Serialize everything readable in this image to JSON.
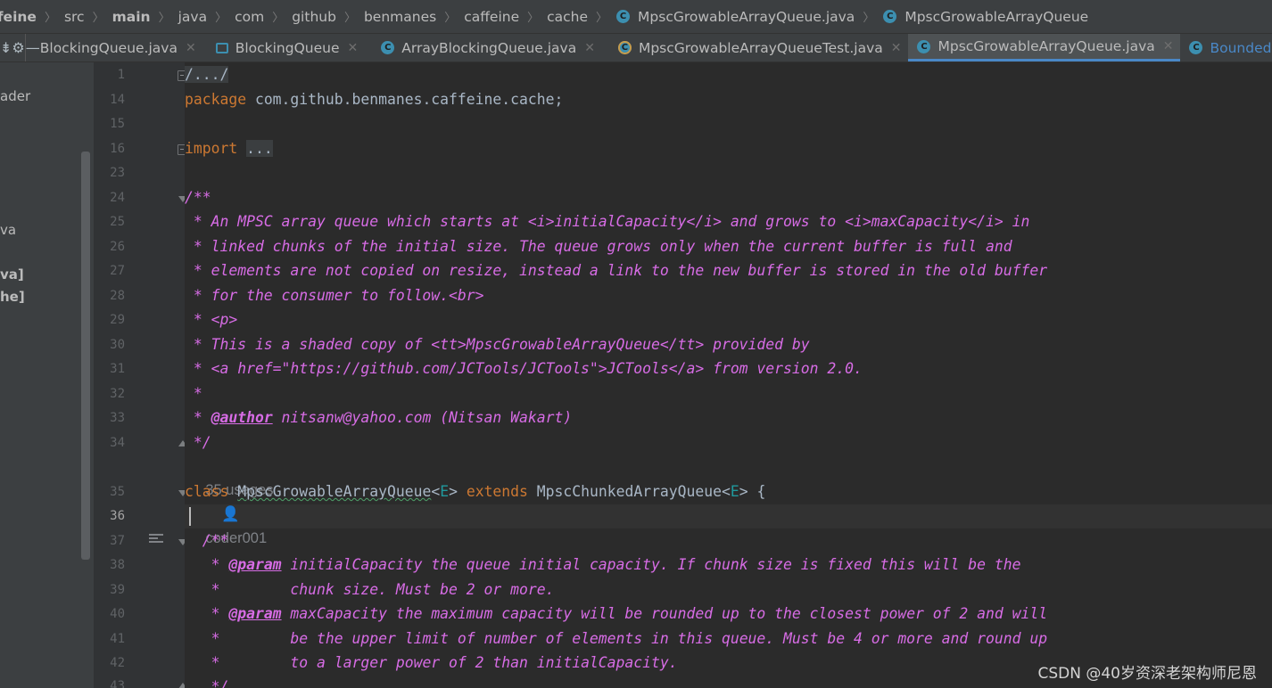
{
  "breadcrumb": [
    {
      "label": "ffeine",
      "bold": true
    },
    {
      "label": "src",
      "bold": false
    },
    {
      "label": "main",
      "bold": true
    },
    {
      "label": "java",
      "bold": false
    },
    {
      "label": "com",
      "bold": false
    },
    {
      "label": "github",
      "bold": false
    },
    {
      "label": "benmanes",
      "bold": false
    },
    {
      "label": "caffeine",
      "bold": false
    },
    {
      "label": "cache",
      "bold": false
    },
    {
      "label": "MpscGrowableArrayQueue.java",
      "bold": false,
      "icon": "class-icon"
    },
    {
      "label": "MpscGrowableArrayQueue",
      "bold": false,
      "icon": "class-icon"
    }
  ],
  "tabs": [
    {
      "label": "BlockingQueue.java",
      "icon": "none",
      "active": false
    },
    {
      "label": "BlockingQueue",
      "icon": "interface-icon",
      "active": false
    },
    {
      "label": "ArrayBlockingQueue.java",
      "icon": "class-icon",
      "active": false
    },
    {
      "label": "MpscGrowableArrayQueueTest.java",
      "icon": "test-class-icon",
      "active": false
    },
    {
      "label": "MpscGrowableArrayQueue.java",
      "icon": "class-icon",
      "active": true
    },
    {
      "label": "Bounded",
      "icon": "class-icon",
      "active": false,
      "partial": true
    }
  ],
  "toolbar": {
    "collapse_icon": "collapse-all-icon",
    "settings_icon": "gear-icon",
    "hide_icon": "minimize-icon"
  },
  "left_panel": [
    {
      "label": "ader",
      "bold": false
    },
    {
      "label": "va",
      "bold": false
    },
    {
      "label": "va]",
      "bold": true
    },
    {
      "label": "he]",
      "bold": true
    }
  ],
  "editor": {
    "line_numbers": [
      "1",
      "14",
      "15",
      "16",
      "23",
      "24",
      "25",
      "26",
      "27",
      "28",
      "29",
      "30",
      "31",
      "32",
      "33",
      "34",
      "",
      "35",
      "36",
      "37",
      "38",
      "39",
      "40",
      "41",
      "42",
      "43"
    ],
    "current_line": "36",
    "fold_collapsed": "/.../",
    "package_kw": "package",
    "package_name": " com.github.benmanes.caffeine.cache;",
    "import_kw": "import",
    "import_fold": "...",
    "doc_open": "/**",
    "doc_lines": [
      " * An MPSC array queue which starts at <i>initialCapacity</i> and grows to <i>maxCapacity</i> in",
      " * linked chunks of the initial size. The queue grows only when the current buffer is full and",
      " * elements are not copied on resize, instead a link to the new buffer is stored in the old buffer",
      " * for the consumer to follow.<br>",
      " * <p>",
      " * This is a shaded copy of <tt>MpscGrowableArrayQueue</tt> provided by",
      " * <a href=\"https://github.com/JCTools/JCTools\">JCTools</a> from version 2.0.",
      " *"
    ],
    "author_prefix": " * ",
    "author_tag": "@author",
    "author_value": " nitsanw@yahoo.com (Nitsan Wakart)",
    "doc_close": " */",
    "inlay_usages": "35 usages",
    "inlay_author": "coder001",
    "class_kw": "class",
    "class_name": "MpscGrowableArrayQueue",
    "generic_e": "E",
    "extends_kw": "extends",
    "super_name": "MpscChunkedArrayQueue",
    "brace": "{",
    "param_doc_open": "  /**",
    "param_tag": "@param",
    "param_lines": [
      {
        "prefix": "   * ",
        "tag": true,
        "text": " initialCapacity the queue initial capacity. If chunk size is fixed this will be the"
      },
      {
        "prefix": "   *        ",
        "tag": false,
        "text": "chunk size. Must be 2 or more."
      },
      {
        "prefix": "   * ",
        "tag": true,
        "text": " maxCapacity the maximum capacity will be rounded up to the closest power of 2 and will"
      },
      {
        "prefix": "   *        ",
        "tag": false,
        "text": "be the upper limit of number of elements in this queue. Must be 4 or more and round up"
      },
      {
        "prefix": "   *        ",
        "tag": false,
        "text": "to a larger power of 2 than initialCapacity."
      }
    ],
    "last_partial": "   */"
  },
  "watermark": "CSDN @40岁资深老架构师尼恩",
  "colors": {
    "keyword": "#cc7832",
    "doc": "#d76ce5",
    "plain": "#a9b7c6",
    "accent": "#4a88c7",
    "background": "#2b2b2b"
  }
}
